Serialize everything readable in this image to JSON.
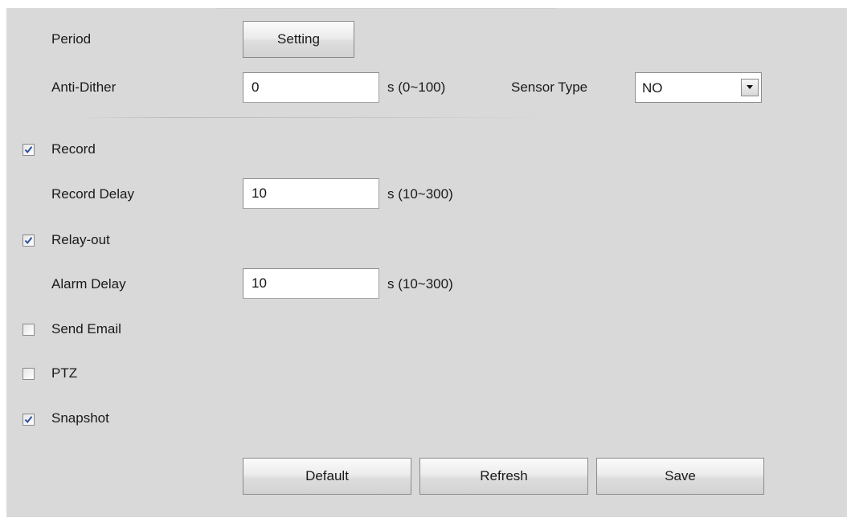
{
  "period": {
    "label": "Period",
    "button_label": "Setting"
  },
  "anti_dither": {
    "label": "Anti-Dither",
    "value": "0",
    "unit": "s (0~100)"
  },
  "sensor_type": {
    "label": "Sensor Type",
    "value": "NO"
  },
  "record": {
    "label": "Record",
    "checked": true
  },
  "record_delay": {
    "label": "Record Delay",
    "value": "10",
    "unit": "s (10~300)"
  },
  "relay_out": {
    "label": "Relay-out",
    "checked": true
  },
  "alarm_delay": {
    "label": "Alarm Delay",
    "value": "10",
    "unit": "s (10~300)"
  },
  "send_email": {
    "label": "Send Email",
    "checked": false
  },
  "ptz": {
    "label": "PTZ",
    "checked": false
  },
  "snapshot": {
    "label": "Snapshot",
    "checked": true
  },
  "actions": {
    "default_label": "Default",
    "refresh_label": "Refresh",
    "save_label": "Save"
  },
  "colors": {
    "panel_background": "#d9d9d9",
    "check_mark": "#2a4f9e"
  }
}
